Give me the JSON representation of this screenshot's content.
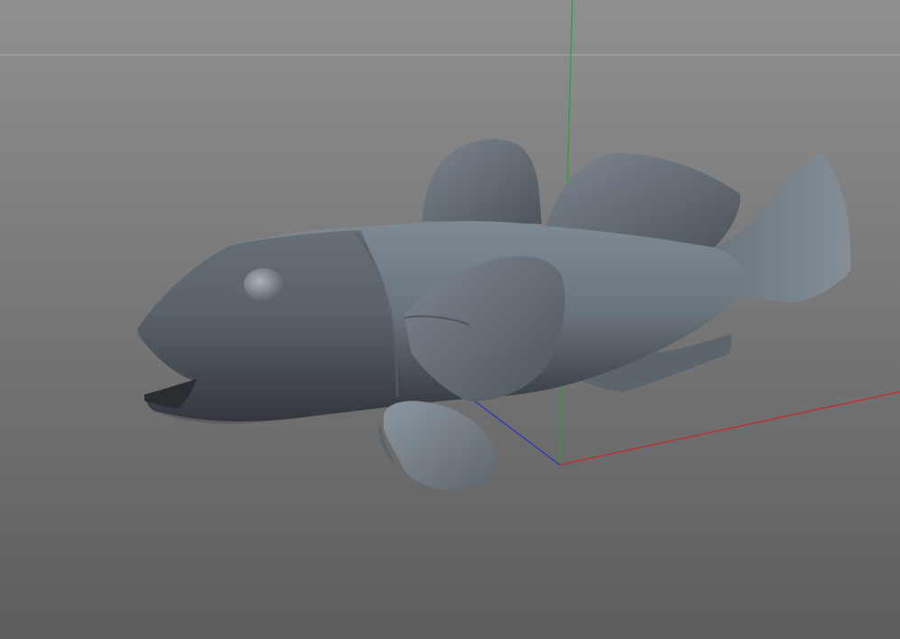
{
  "viewport": {
    "mode": "perspective",
    "background_top": "#8e8e8e",
    "background_bottom": "#5c5c5c",
    "horizon_color": "#a7a7a7",
    "object_color": "#6e7880"
  },
  "axes": {
    "x_color": "#c8262b",
    "y_color": "#1ea82a",
    "z_color": "#2531c8"
  },
  "scene": {
    "object_kind": "fish-model"
  }
}
